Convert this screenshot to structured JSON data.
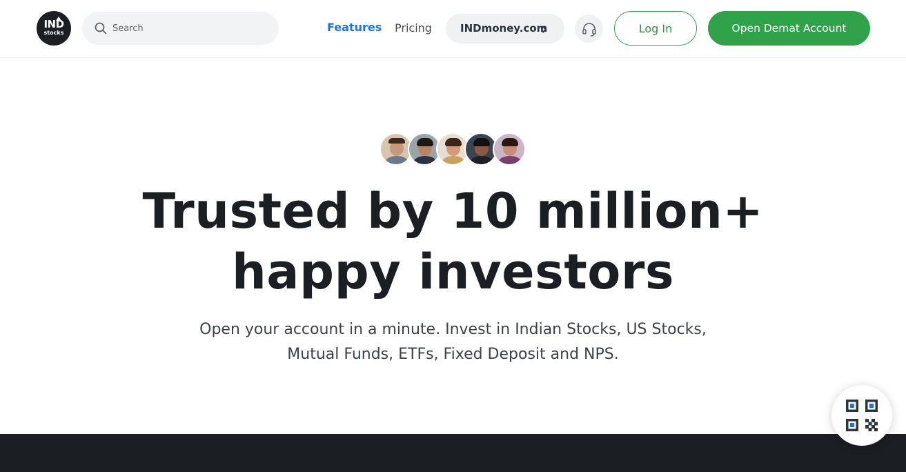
{
  "header": {
    "logo": {
      "line1": "IND",
      "line2": "stocks"
    },
    "search": {
      "placeholder": "Search",
      "icon": "search-icon"
    },
    "nav": {
      "features": "Features",
      "pricing": "Pricing",
      "indmoney": "INDmoney.com"
    },
    "support_icon": "headset-icon",
    "login_label": "Log In",
    "cta_label": "Open Demat Account"
  },
  "hero": {
    "avatar_count": 5,
    "headline_line1": "Trusted by 10 million+",
    "headline_line2": "happy investors",
    "subhead_line1": "Open your account in a minute. Invest in Indian Stocks, US Stocks,",
    "subhead_line2": "Mutual Funds, ETFs, Fixed Deposit and NPS."
  },
  "qr_fab": {
    "icon": "qr-code-icon"
  },
  "colors": {
    "brand_green": "#2fa24a",
    "link_blue": "#1a73e8",
    "dark": "#1b1e22"
  }
}
